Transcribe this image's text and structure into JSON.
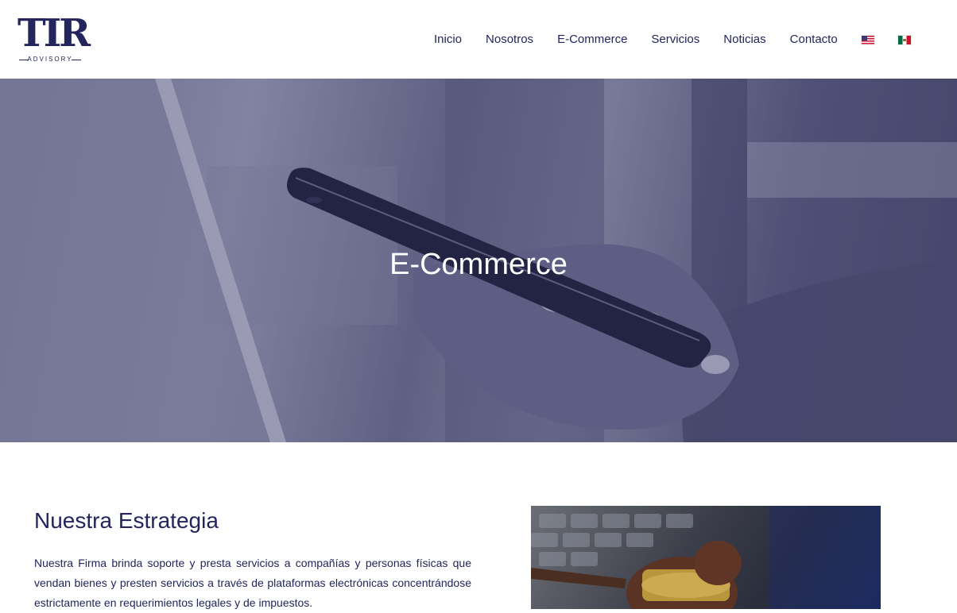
{
  "brand": {
    "logo_mark": "TIR",
    "logo_sub": "ADVISORY"
  },
  "nav": {
    "items": [
      "Inicio",
      "Nosotros",
      "E-Commerce",
      "Servicios",
      "Noticias",
      "Contacto"
    ],
    "flags": [
      "us-flag-icon",
      "mexico-flag-icon"
    ]
  },
  "hero": {
    "title": "E-Commerce"
  },
  "content": {
    "title": "Nuestra Estrategia",
    "paragraph": "Nuestra Firma brinda soporte y presta servicios a compañías y personas físicas que vendan bienes y presten servicios a través de plataformas electrónicas concentrándose estrictamente en requerimientos legales y de impuestos."
  },
  "colors": {
    "brand_navy": "#23255c",
    "hero_tint": "#5a5a80"
  }
}
